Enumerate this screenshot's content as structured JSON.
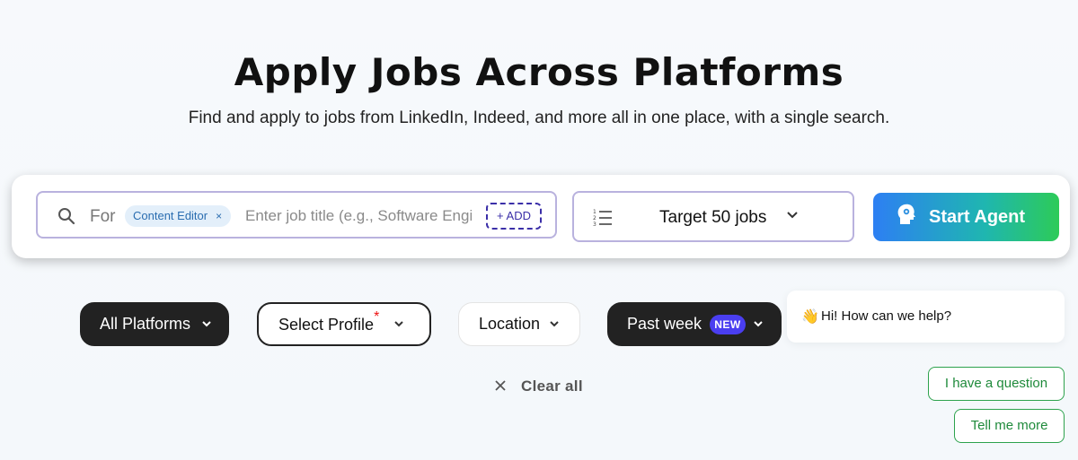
{
  "header": {
    "title": "Apply Jobs Across Platforms",
    "subtitle": "Find and apply to jobs from LinkedIn, Indeed, and more all in one place, with a single search."
  },
  "search": {
    "for_label": "For",
    "chips": [
      {
        "label": "Content Editor",
        "remove": "×"
      }
    ],
    "placeholder": "Enter job title (e.g., Software Engineer)",
    "add_label": "+ ADD",
    "target_label": "Target 50 jobs",
    "start_label": "Start Agent"
  },
  "filters": {
    "platforms": "All Platforms",
    "profile": "Select Profile",
    "profile_required_mark": "*",
    "location": "Location",
    "date": "Past week",
    "date_badge": "NEW",
    "clear_all": "Clear all"
  },
  "chat": {
    "wave_emoji": "👋",
    "greeting": "Hi! How can we help?",
    "options": [
      "I have a question",
      "Tell me more"
    ]
  },
  "colors": {
    "accent_purple": "#3b2fa8",
    "badge": "#4a3ef0",
    "start_gradient": [
      "#2d7ff3",
      "#2dcb58"
    ],
    "chat_green": "#1f8a3b"
  },
  "icons": [
    "search-icon",
    "close-icon",
    "list-numbered-icon",
    "chevron-down-icon",
    "agent-head-icon"
  ]
}
